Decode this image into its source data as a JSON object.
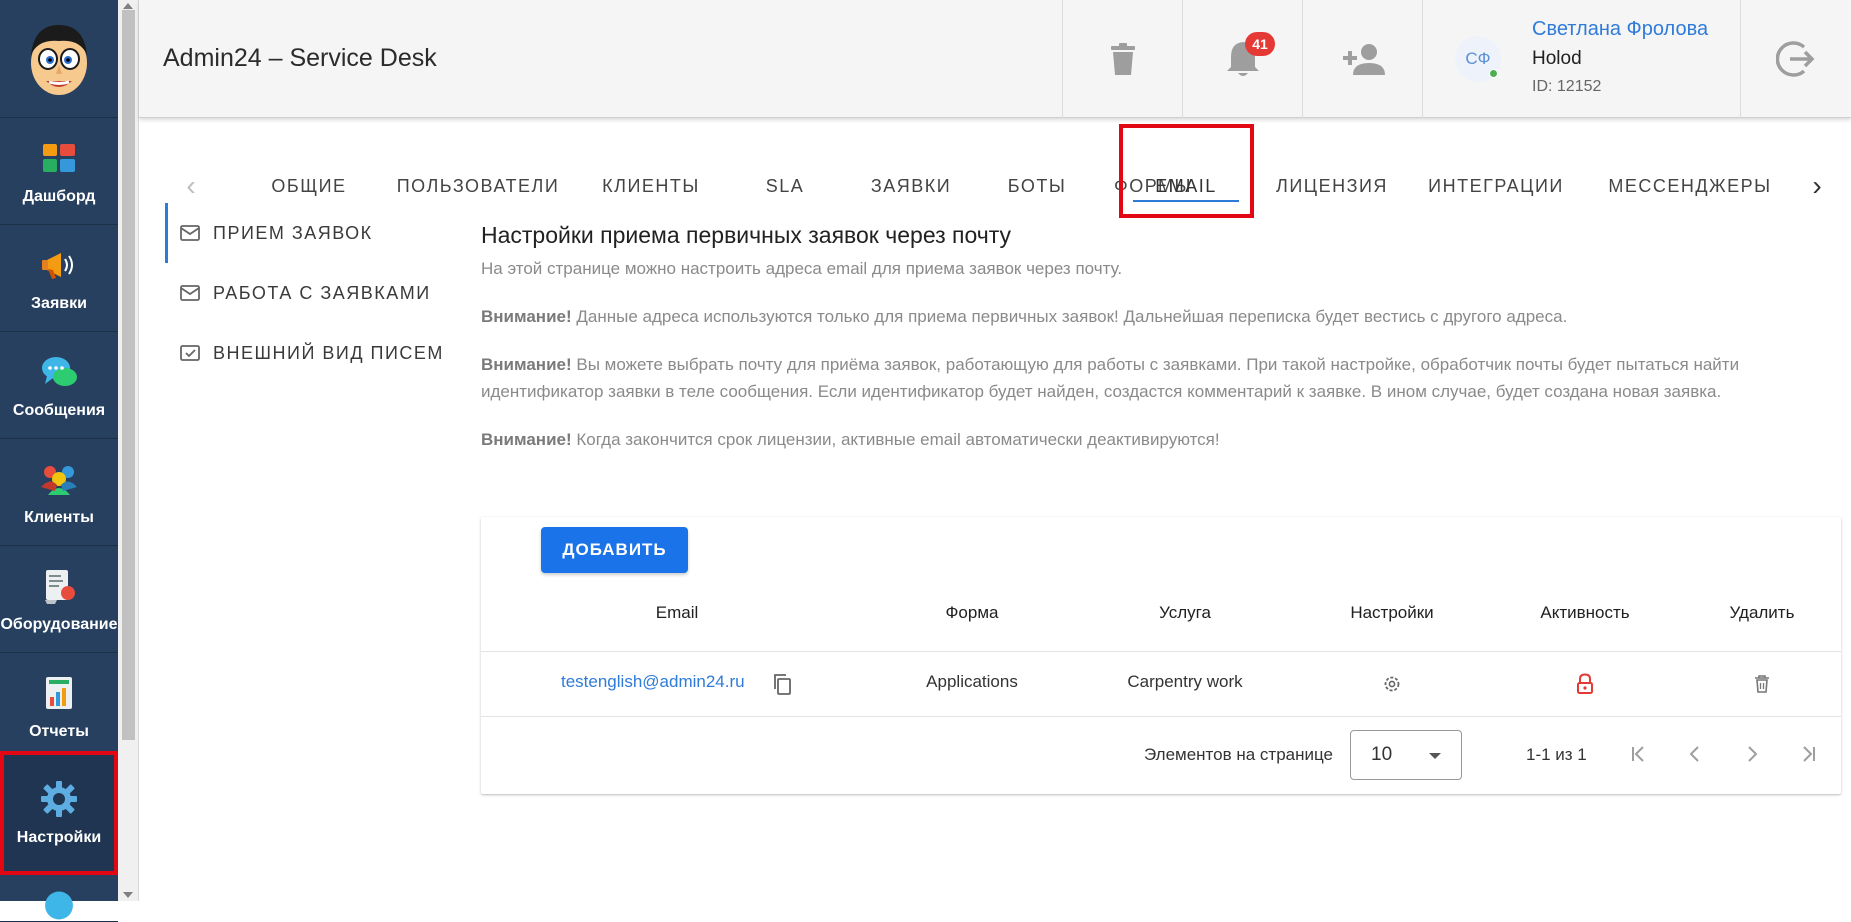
{
  "sidebar": {
    "items": [
      {
        "label": "Дашборд",
        "icon": "dashboard-icon"
      },
      {
        "label": "Заявки",
        "icon": "megaphone-icon"
      },
      {
        "label": "Сообщения",
        "icon": "chat-bubbles-icon"
      },
      {
        "label": "Клиенты",
        "icon": "clients-icon"
      },
      {
        "label": "Оборудование",
        "icon": "equipment-icon"
      },
      {
        "label": "Отчеты",
        "icon": "reports-icon"
      },
      {
        "label": "Настройки",
        "icon": "gear-icon"
      }
    ],
    "active_index": 6
  },
  "header": {
    "title": "Admin24 – Service Desk",
    "notifications_count": "41",
    "user": {
      "initials": "СФ",
      "name": "Светлана Фролова",
      "org": "Holod",
      "id": "ID: 12152"
    }
  },
  "tabs": [
    {
      "label": "ОБЩИЕ"
    },
    {
      "label": "ПОЛЬЗОВАТЕЛИ"
    },
    {
      "label": "КЛИЕНТЫ"
    },
    {
      "label": "SLA"
    },
    {
      "label": "ЗАЯВКИ"
    },
    {
      "label": "БОТЫ"
    },
    {
      "label": "ФОРМЫ"
    },
    {
      "label": "EMAIL"
    },
    {
      "label": "ЛИЦЕНЗИЯ"
    },
    {
      "label": "ИНТЕГРАЦИИ"
    },
    {
      "label": "МЕССЕНДЖЕРЫ"
    }
  ],
  "active_tab": "EMAIL",
  "submenu": [
    {
      "label": "ПРИЕМ ЗАЯВОК"
    },
    {
      "label": "РАБОТА С ЗАЯВКАМИ"
    },
    {
      "label": "ВНЕШНИЙ ВИД ПИСЕМ"
    }
  ],
  "content": {
    "title": "Настройки приема первичных заявок через почту",
    "intro": "На этой странице можно настроить адреса email для приема заявок через почту.",
    "warning_label": "Внимание!",
    "warnings": [
      "Данные адреса используются только для приема первичных заявок! Дальнейшая переписка будет вестись с другого адреса.",
      "Вы можете выбрать почту для приёма заявок, работающую для работы с заявками. При такой настройке, обработчик почты будет пытаться найти идентификатор заявки в теле сообщения. Если идентификатор будет найден, создастся комментарий к заявке. В ином случае, будет создана новая заявка.",
      "Когда закончится срок лицензии, активные email автоматически деактивируются!"
    ]
  },
  "table": {
    "add_button": "ДОБАВИТЬ",
    "columns": [
      "Email",
      "Форма",
      "Услуга",
      "Настройки",
      "Активность",
      "Удалить"
    ],
    "rows": [
      {
        "email": "testenglish@admin24.ru",
        "form": "Applications",
        "service": "Carpentry work"
      }
    ],
    "paginator": {
      "items_per_page_label": "Элементов на странице",
      "page_size": "10",
      "range": "1-1 из 1"
    }
  },
  "colors": {
    "sidebar_bg": "#27405f",
    "accent": "#1a73e8",
    "link": "#2f7bd8",
    "highlight": "#e30613",
    "lock": "#e53935"
  }
}
